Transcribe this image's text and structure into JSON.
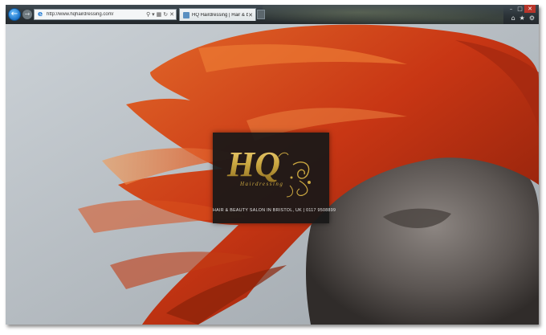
{
  "browser": {
    "url": "http://www.hqhairdressing.com/",
    "tab_title": "HQ Hairdressing | Hair & b...",
    "nav": {
      "back_icon": "arrow-left-icon",
      "forward_icon": "arrow-right-icon"
    }
  },
  "page": {
    "logo": {
      "initials": "HQ",
      "wordmark": "Hairdressing"
    },
    "tagline": "HAIR & BEAUTY SALON IN BRISTOL, UK | 0117 9508899"
  },
  "colors": {
    "logo_gold": "#c9a640",
    "card": "#181818",
    "hair_red": "#d8461c"
  }
}
